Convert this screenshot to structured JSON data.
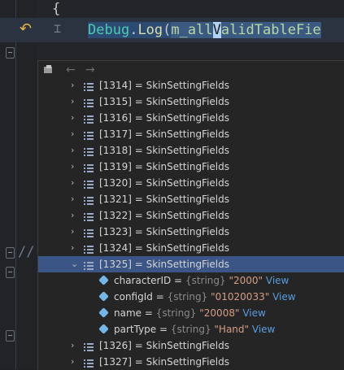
{
  "editor": {
    "brace": "{",
    "code": {
      "class_name": "Debug",
      "dot": ".",
      "method": "Log",
      "open_paren": "(",
      "arg_prefix": "m_all",
      "arg_caret_char": "V",
      "arg_suffix": "alidTableFie"
    },
    "comment_mark": "//"
  },
  "popup": {
    "toolbar": {
      "pin_icon": "pin-icon",
      "back_icon": "back-arrow-icon",
      "forward_icon": "forward-arrow-icon"
    },
    "items_before": [
      {
        "label": "[1314] = SkinSettingFields"
      },
      {
        "label": "[1315] = SkinSettingFields"
      },
      {
        "label": "[1316] = SkinSettingFields"
      },
      {
        "label": "[1317] = SkinSettingFields"
      },
      {
        "label": "[1318] = SkinSettingFields"
      },
      {
        "label": "[1319] = SkinSettingFields"
      },
      {
        "label": "[1320] = SkinSettingFields"
      },
      {
        "label": "[1321] = SkinSettingFields"
      },
      {
        "label": "[1322] = SkinSettingFields"
      },
      {
        "label": "[1323] = SkinSettingFields"
      },
      {
        "label": "[1324] = SkinSettingFields"
      }
    ],
    "expanded_item": {
      "label": "[1325] = SkinSettingFields",
      "properties": [
        {
          "name": "characterID = ",
          "type": "{string}",
          "value": "\"2000\"",
          "view": "View"
        },
        {
          "name": "configId = ",
          "type": "{string}",
          "value": "\"01020033\"",
          "view": "View"
        },
        {
          "name": "name = ",
          "type": "{string}",
          "value": "\"20008\"",
          "view": "View"
        },
        {
          "name": "partType = ",
          "type": "{string}",
          "value": "\"Hand\"",
          "view": "View"
        }
      ]
    },
    "items_after": [
      {
        "label": "[1326] = SkinSettingFields"
      },
      {
        "label": "[1327] = SkinSettingFields"
      }
    ]
  }
}
